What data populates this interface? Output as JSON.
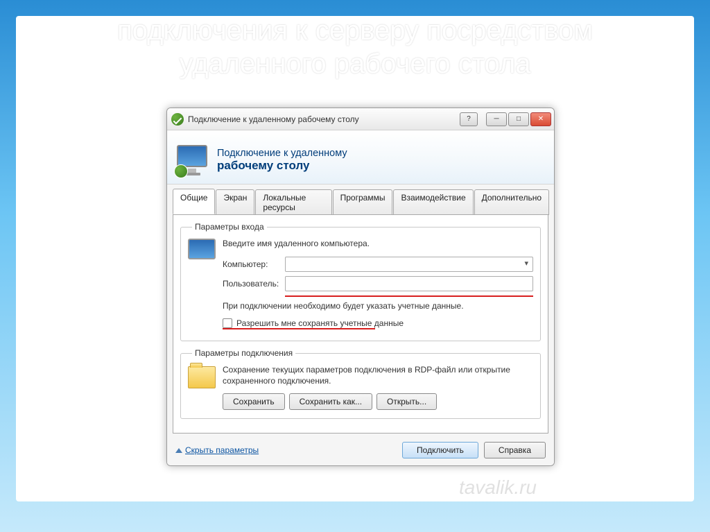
{
  "slide": {
    "title_line1": "подключения к серверу посредством",
    "title_line2": "удаленного рабочего стола"
  },
  "titlebar": {
    "text": "Подключение к удаленному рабочему столу"
  },
  "banner": {
    "line1": "Подключение к удаленному",
    "line2": "рабочему столу"
  },
  "tabs": [
    {
      "label": "Общие",
      "active": true
    },
    {
      "label": "Экран",
      "active": false
    },
    {
      "label": "Локальные ресурсы",
      "active": false
    },
    {
      "label": "Программы",
      "active": false
    },
    {
      "label": "Взаимодействие",
      "active": false
    },
    {
      "label": "Дополнительно",
      "active": false
    }
  ],
  "login_group": {
    "legend": "Параметры входа",
    "instruction": "Введите имя удаленного компьютера.",
    "computer_label": "Компьютер:",
    "computer_value": "",
    "user_label": "Пользователь:",
    "user_value": "",
    "note": "При подключении необходимо будет указать учетные данные.",
    "save_creds_label": "Разрешить мне сохранять учетные данные"
  },
  "conn_group": {
    "legend": "Параметры подключения",
    "text": "Сохранение текущих параметров подключения в RDP-файл или открытие сохраненного подключения.",
    "save_label": "Сохранить",
    "save_as_label": "Сохранить как...",
    "open_label": "Открыть..."
  },
  "footer": {
    "toggle_label": "Скрыть параметры",
    "connect_label": "Подключить",
    "help_label": "Справка"
  },
  "watermark": "tavalik.ru"
}
